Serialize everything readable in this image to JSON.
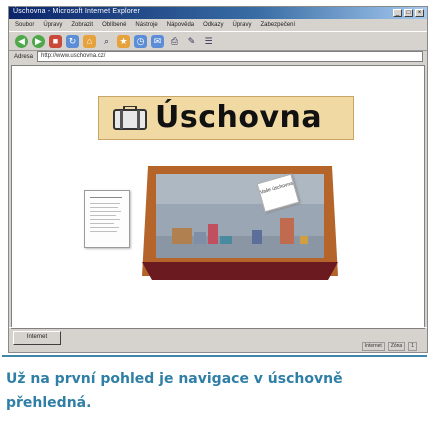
{
  "browser": {
    "title": "Úschovna - Microsoft Internet Explorer",
    "menu": [
      "Soubor",
      "Úpravy",
      "Zobrazit",
      "Oblíbené",
      "Nástroje",
      "Nápověda",
      "Odkazy",
      "Úpravy",
      "Zabezpečení"
    ],
    "address_label": "Adresa",
    "address_value": "http://www.uschovna.cz/",
    "toolbar_icons": [
      "back-icon",
      "forward-icon",
      "stop-icon",
      "refresh-icon",
      "home-icon",
      "search-icon",
      "favorites-icon",
      "history-icon",
      "mail-icon",
      "print-icon",
      "edit-icon",
      "discuss-icon"
    ]
  },
  "page": {
    "banner_title": "Úschovna",
    "note_text": "Vaše\núschovna"
  },
  "statusbar": {
    "task_label": "Internet",
    "zones": [
      "Internet",
      "Zóna",
      "1"
    ]
  },
  "caption": "Už na první pohled je navigace v úschovně přehledná.",
  "colors": {
    "caption": "#2f7fa6",
    "banner": "#f1d9a4",
    "frame": "#b5642a",
    "shelf_floor": "#6b1a1f"
  }
}
